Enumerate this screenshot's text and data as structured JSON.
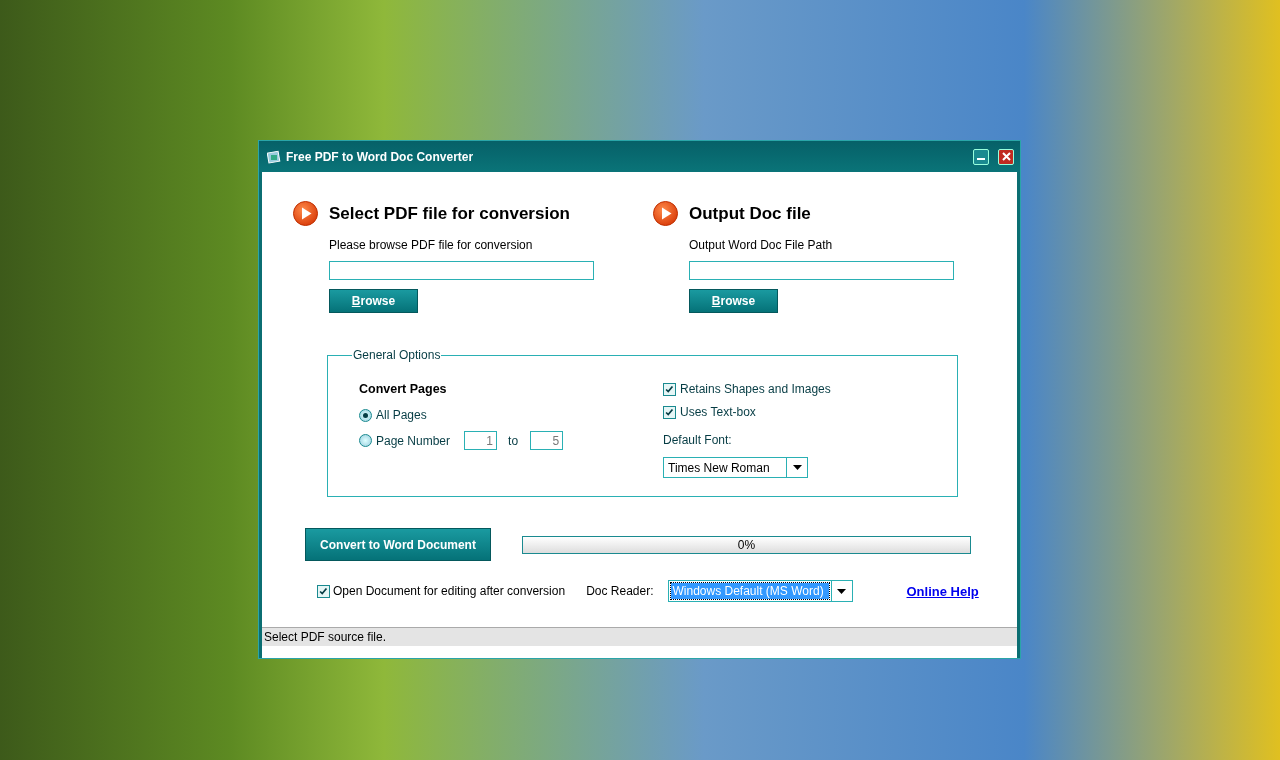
{
  "window": {
    "title": "Free PDF to Word Doc Converter"
  },
  "sections": [
    {
      "heading": "Select PDF file for conversion",
      "description": "Please browse PDF file for conversion",
      "button": {
        "label": "Browse"
      }
    },
    {
      "heading": "Output Doc file",
      "description": "Output Word Doc File Path",
      "button": {
        "label": "Browse"
      }
    }
  ],
  "general_options": {
    "legend": "General Options",
    "convert_pages": {
      "heading": "Convert Pages",
      "options": [
        {
          "label": "All Pages",
          "selected": true
        },
        {
          "label": "Page Number",
          "selected": false
        }
      ],
      "from": "1",
      "to_label": "to",
      "to": "5"
    },
    "checkboxes": [
      {
        "label": "Retains Shapes and Images",
        "checked": true
      },
      {
        "label": "Uses Text-box",
        "checked": true
      }
    ],
    "default_font": {
      "label": "Default Font:",
      "value": "Times New Roman"
    }
  },
  "convert_button": "Convert to Word Document",
  "progress": {
    "level": 0,
    "reading": "0%"
  },
  "open_after": {
    "label": "Open Document for editing after conversion",
    "checked": true
  },
  "doc_reader": {
    "label": "Doc Reader:",
    "value": "Windows Default (MS Word)"
  },
  "online_help": "Online Help",
  "status_bar": "Select PDF source file."
}
